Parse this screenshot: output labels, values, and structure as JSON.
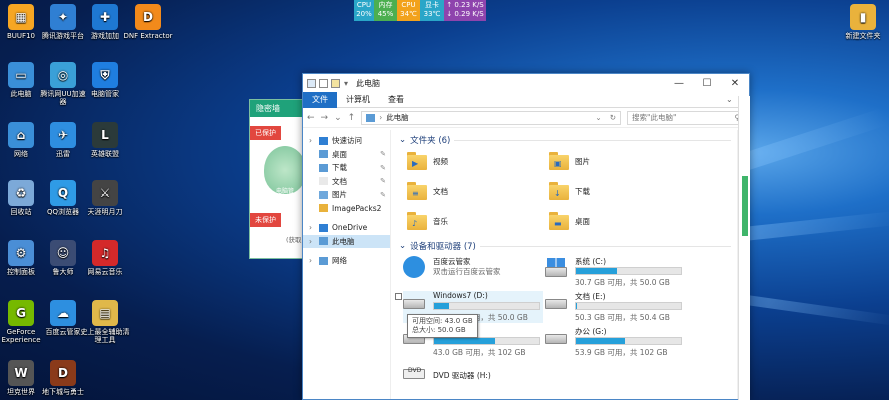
{
  "perf": [
    {
      "label": "CPU",
      "value": "20%",
      "color": "#2aa6c8"
    },
    {
      "label": "内存",
      "value": "45%",
      "color": "#4caf50"
    },
    {
      "label": "CPU",
      "value": "34℃",
      "color": "#f2a21c"
    },
    {
      "label": "显卡",
      "value": "33℃",
      "color": "#2aa6c8"
    },
    {
      "label": "↑ 0.23 K/S",
      "value": "↓ 0.29 K/S",
      "color": "#8e44ad"
    }
  ],
  "desktop_icons": [
    {
      "label": "BUUF10",
      "color": "#f6a623",
      "glyph": "▦"
    },
    {
      "label": "腾讯游戏平台",
      "color": "#2f7fd3",
      "glyph": "✦"
    },
    {
      "label": "游戏加加",
      "color": "#1e78d2",
      "glyph": "✚"
    },
    {
      "label": "DNF Extractor",
      "color": "#f28a1b",
      "glyph": "D"
    },
    {
      "label": "此电脑",
      "color": "#3a8fd8",
      "glyph": "▭"
    },
    {
      "label": "腾讯网UU加速器",
      "color": "#3aa0d8",
      "glyph": "◎"
    },
    {
      "label": "电脑管家",
      "color": "#1f7ee0",
      "glyph": "⛨"
    },
    {
      "label": "网络",
      "color": "#3a8fd8",
      "glyph": "⌂"
    },
    {
      "label": "迅雷",
      "color": "#2e8ee0",
      "glyph": "✈"
    },
    {
      "label": "英雄联盟",
      "color": "#2b3a3a",
      "glyph": "L"
    },
    {
      "label": "回收站",
      "color": "#7ca9d8",
      "glyph": "♻"
    },
    {
      "label": "QQ浏览器",
      "color": "#2f9be6",
      "glyph": "Q"
    },
    {
      "label": "天涯明月刀",
      "color": "#444444",
      "glyph": "⚔"
    },
    {
      "label": "控制面板",
      "color": "#4a8ed6",
      "glyph": "⚙"
    },
    {
      "label": "鲁大师",
      "color": "#3b4c74",
      "glyph": "☺"
    },
    {
      "label": "网易云音乐",
      "color": "#d4292a",
      "glyph": "♫"
    },
    {
      "label": "GeForce Experience",
      "color": "#76b900",
      "glyph": "G"
    },
    {
      "label": "百度云管家",
      "color": "#2d8fe0",
      "glyph": "☁"
    },
    {
      "label": "史上最全辅助清理工具",
      "color": "#e0b84a",
      "glyph": "▤"
    },
    {
      "label": "坦克世界",
      "color": "#555555",
      "glyph": "W"
    },
    {
      "label": "地下城与勇士",
      "color": "#8a3a1a",
      "glyph": "D"
    },
    {
      "label": "新建文件夹",
      "color": "#e9b23c",
      "glyph": "▮"
    }
  ],
  "security_window": {
    "title": "隐密墙",
    "tag1": "已保护",
    "tag2": "未保护",
    "note": "(获取",
    "text": "电脑管"
  },
  "explorer": {
    "title": "此电脑",
    "ribbon_tabs": [
      "文件",
      "计算机",
      "查看"
    ],
    "address_path": "此电脑",
    "search_placeholder": "搜索\"此电脑\"",
    "nav": [
      {
        "label": "快速访问",
        "icon": "star-icon",
        "pin": false,
        "selected": false
      },
      {
        "label": "桌面",
        "icon": "desktop-icon",
        "pin": true,
        "selected": false
      },
      {
        "label": "下载",
        "icon": "download-icon",
        "pin": true,
        "selected": false
      },
      {
        "label": "文档",
        "icon": "document-icon",
        "pin": true,
        "selected": false
      },
      {
        "label": "图片",
        "icon": "picture-icon",
        "pin": true,
        "selected": false
      },
      {
        "label": "ImagePacks2",
        "icon": "folder-icon",
        "pin": false,
        "selected": false
      },
      {
        "label": "OneDrive",
        "icon": "cloud-icon",
        "pin": false,
        "selected": false
      },
      {
        "label": "此电脑",
        "icon": "computer-icon",
        "pin": false,
        "selected": true
      },
      {
        "label": "网络",
        "icon": "network-icon",
        "pin": false,
        "selected": false
      }
    ],
    "folders_header": "文件夹 (6)",
    "folders": [
      {
        "label": "视频",
        "glyph": "▶"
      },
      {
        "label": "图片",
        "glyph": "▣"
      },
      {
        "label": "文档",
        "glyph": "≡"
      },
      {
        "label": "下载",
        "glyph": "↓"
      },
      {
        "label": "音乐",
        "glyph": "♪"
      },
      {
        "label": "桌面",
        "glyph": "▬"
      }
    ],
    "drives_header": "设备和驱动器 (7)",
    "drives": [
      {
        "name": "百度云管家",
        "free": "双击运行百度云管家",
        "fill": 0,
        "kind": "baidu"
      },
      {
        "name": "系统 (C:)",
        "free": "30.7 GB 可用，共 50.0 GB",
        "fill": 0.39,
        "kind": "win"
      },
      {
        "name": "Windows7 (D:)",
        "free": "43.0 GB 可用，共 50.0 GB",
        "fill": 0.14,
        "kind": "hdd"
      },
      {
        "name": "文档 (E:)",
        "free": "50.3 GB 可用，共 50.4 GB",
        "fill": 0.01,
        "kind": "hdd"
      },
      {
        "name": "",
        "free": "43.0 GB 可用，共 102 GB",
        "fill": 0.58,
        "kind": "hdd"
      },
      {
        "name": "办公 (G:)",
        "free": "53.9 GB 可用，共 102 GB",
        "fill": 0.47,
        "kind": "hdd"
      },
      {
        "name": "DVD 驱动器 (H:)",
        "free": "",
        "fill": 0,
        "kind": "dvd"
      }
    ],
    "tooltip": {
      "line1": "可用空间: 43.0 GB",
      "line2": "总大小: 50.0 GB"
    }
  }
}
